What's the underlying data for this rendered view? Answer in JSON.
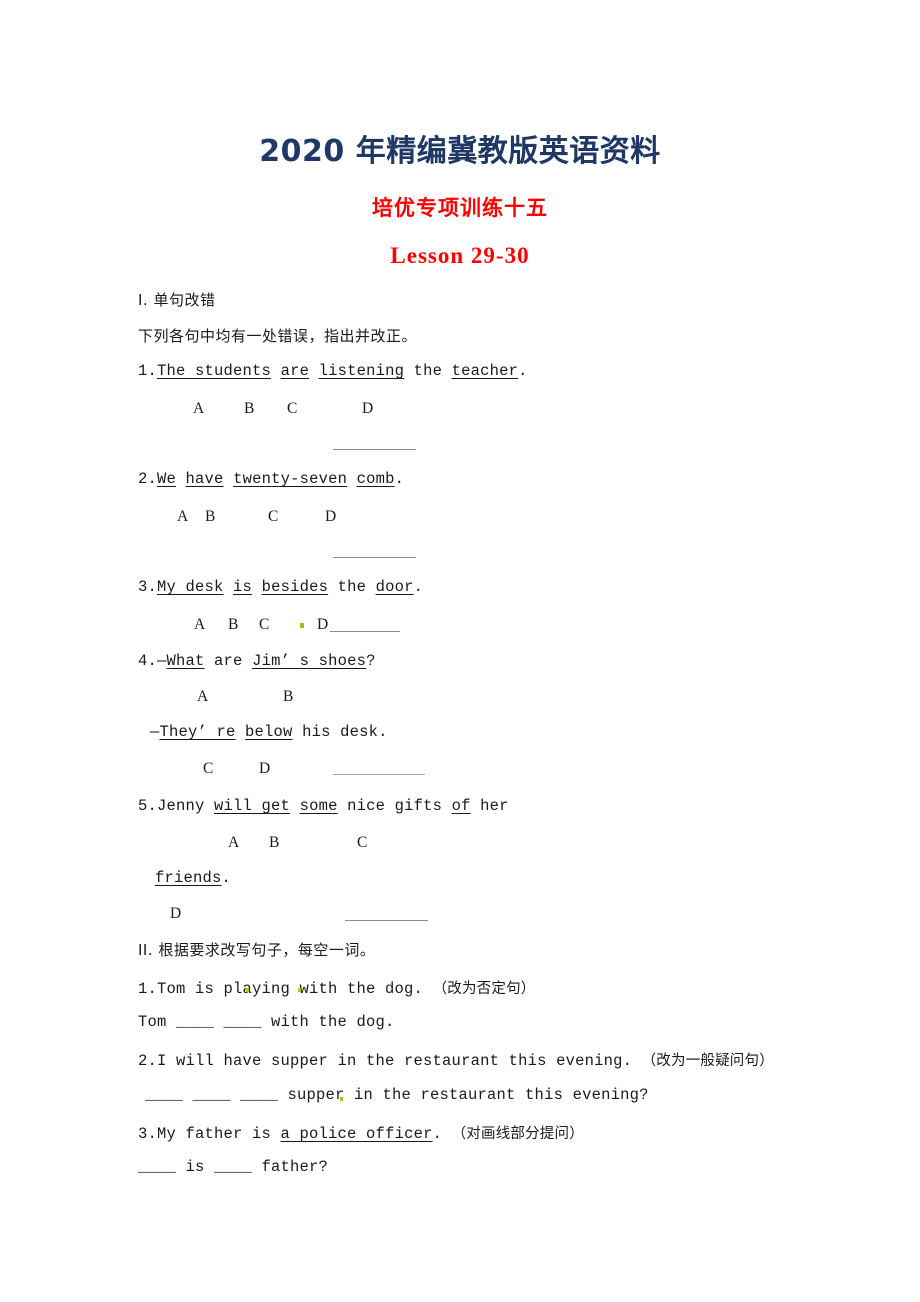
{
  "document": {
    "title": "2020 年精编冀教版英语资料",
    "subtitle": "培优专项训练十五",
    "lesson": "Lesson 29-30",
    "colors": {
      "title": "#1F3864",
      "subtitle": "#FF0000",
      "lesson": "#FF0000",
      "body": "#1A1A1A",
      "rule": "#8A8A8A",
      "artifact": "#B5B800"
    }
  },
  "section_one": {
    "heading": "I. 单句改错",
    "instruction": "下列各句中均有一处错误，指出并改正。",
    "items": [
      {
        "number": "1.",
        "sentence_parts": [
          {
            "text": "The students",
            "underline": true
          },
          {
            "text": " ",
            "underline": false
          },
          {
            "text": "are",
            "underline": true
          },
          {
            "text": " ",
            "underline": false
          },
          {
            "text": "listening",
            "underline": true
          },
          {
            "text": " the ",
            "underline": false
          },
          {
            "text": "teacher",
            "underline": true
          },
          {
            "text": ".",
            "underline": false
          }
        ],
        "options": [
          "A",
          "B",
          "C",
          "D"
        ]
      },
      {
        "number": "2.",
        "sentence_parts": [
          {
            "text": "We",
            "underline": true
          },
          {
            "text": " ",
            "underline": false
          },
          {
            "text": "have",
            "underline": true
          },
          {
            "text": " ",
            "underline": false
          },
          {
            "text": "twenty-seven",
            "underline": true
          },
          {
            "text": " ",
            "underline": false
          },
          {
            "text": "comb",
            "underline": true
          },
          {
            "text": ".",
            "underline": false
          }
        ],
        "options": [
          "A",
          "B",
          "C",
          "D"
        ]
      },
      {
        "number": "3.",
        "sentence_parts": [
          {
            "text": "My desk",
            "underline": true
          },
          {
            "text": " ",
            "underline": false
          },
          {
            "text": "is",
            "underline": true
          },
          {
            "text": " ",
            "underline": false
          },
          {
            "text": "besides",
            "underline": true
          },
          {
            "text": " the ",
            "underline": false
          },
          {
            "text": "door",
            "underline": true
          },
          {
            "text": ".",
            "underline": false
          }
        ],
        "options": [
          "A",
          "B",
          "C",
          "D"
        ]
      },
      {
        "number": "4.",
        "sentence_parts": [
          {
            "text": "—",
            "underline": false
          },
          {
            "text": "What",
            "underline": true
          },
          {
            "text": " are ",
            "underline": false
          },
          {
            "text": "Jim’ s shoes",
            "underline": true
          },
          {
            "text": "?",
            "underline": false
          }
        ],
        "sentence_parts_2": [
          {
            "text": "—",
            "underline": false
          },
          {
            "text": "They’ re",
            "underline": true
          },
          {
            "text": " ",
            "underline": false
          },
          {
            "text": "below",
            "underline": true
          },
          {
            "text": " his desk.",
            "underline": false
          }
        ],
        "options": [
          "A",
          "B",
          "C",
          "D"
        ]
      },
      {
        "number": "5.",
        "sentence_parts": [
          {
            "text": "Jenny ",
            "underline": false
          },
          {
            "text": "will get",
            "underline": true
          },
          {
            "text": " ",
            "underline": false
          },
          {
            "text": "some",
            "underline": true
          },
          {
            "text": " nice gifts ",
            "underline": false
          },
          {
            "text": "of",
            "underline": true
          },
          {
            "text": " her",
            "underline": false
          }
        ],
        "sentence_parts_2": [
          {
            "text": "friends",
            "underline": true
          },
          {
            "text": ".",
            "underline": false
          }
        ],
        "options": [
          "A",
          "B",
          "C",
          "D"
        ]
      }
    ]
  },
  "section_two": {
    "heading": "II. 根据要求改写句子，每空一词。",
    "items": [
      {
        "number": "1.",
        "prompt_en": "Tom is playing with the dog.",
        "prompt_cn": "（改为否定句）",
        "answer_line": "Tom ____ ____ with the dog."
      },
      {
        "number": "2.",
        "prompt_en": "I will have supper in the restaurant this evening.",
        "prompt_cn": "（改为一般疑问句）",
        "answer_line": "____ ____ ____ supper in the restaurant this evening?"
      },
      {
        "number": "3.",
        "prompt_en_pre": "My father is ",
        "prompt_en_underlined": "a police officer",
        "prompt_en_post": ".",
        "prompt_cn": "（对画线部分提问）",
        "answer_line": "____ is ____ father?"
      }
    ]
  }
}
